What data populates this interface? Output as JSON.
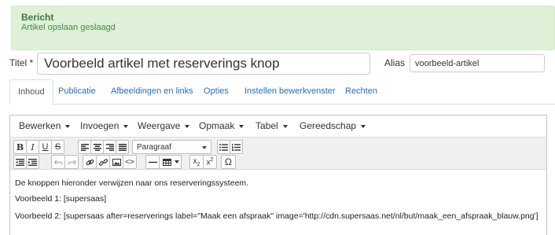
{
  "message": {
    "title": "Bericht",
    "text": "Artikel opslaan geslaagd"
  },
  "form": {
    "title_label": "Titel *",
    "title_value": "Voorbeeld artikel met reserverings knop",
    "alias_label": "Alias",
    "alias_value": "voorbeeld-artikel"
  },
  "tabs": [
    {
      "label": "Inhoud",
      "active": true
    },
    {
      "label": "Publicatie"
    },
    {
      "label": "Afbeeldingen en links"
    },
    {
      "label": "Opties"
    },
    {
      "label": "Instellen bewerkvenster"
    },
    {
      "label": "Rechten"
    }
  ],
  "editor": {
    "menus": [
      "Bewerken",
      "Invoegen",
      "Weergave",
      "Opmaak",
      "Tabel",
      "Gereedschap"
    ],
    "format_select": "Paragraaf",
    "toolbar_icons": {
      "row1": [
        "bold-icon",
        "italic-icon",
        "underline-icon",
        "strikethrough-icon",
        "align-left-icon",
        "align-center-icon",
        "align-right-icon",
        "align-justify-icon",
        "format-dropdown",
        "bullet-list-icon",
        "numbered-list-icon"
      ],
      "row2": [
        "outdent-icon",
        "indent-icon",
        "undo-icon",
        "redo-icon",
        "link-icon",
        "unlink-icon",
        "image-icon",
        "code-icon",
        "horizontal-rule-icon",
        "table-icon",
        "subscript-icon",
        "superscript-icon",
        "omega-icon"
      ]
    },
    "content": [
      "De knoppen hieronder verwijzen naar ons reserveringssysteem.",
      "Voorbeeld 1: [supersaas]",
      "Voorbeeld 2: [supersaas after=reserverings label=\"Maak een afspraak\" image='http://cdn.supersaas.net/nl/but/maak_een_afspraak_blauw.png']"
    ]
  }
}
